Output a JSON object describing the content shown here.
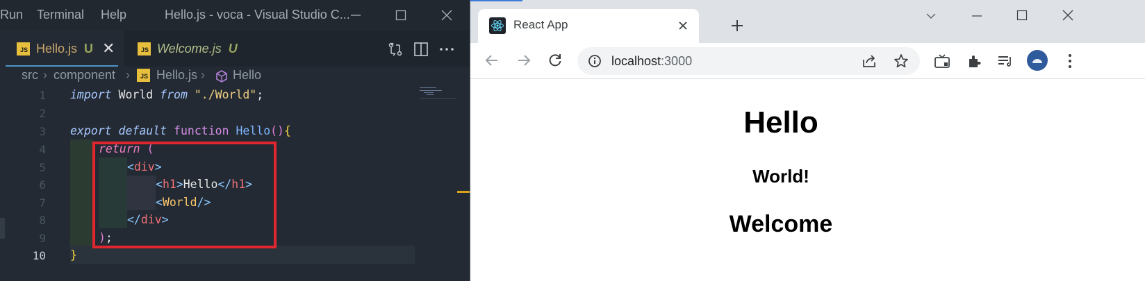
{
  "vscode": {
    "menu": [
      "Run",
      "Terminal",
      "Help"
    ],
    "window_title": "Hello.js - voca - Visual Studio C...",
    "tabs": [
      {
        "name": "Hello.js",
        "status": "U",
        "close": "✕",
        "active": true
      },
      {
        "name": "Welcome.js",
        "status": "U",
        "active": false
      }
    ],
    "breadcrumb": [
      "src",
      "component",
      "Hello.js",
      "Hello"
    ],
    "line_numbers": [
      "1",
      "2",
      "3",
      "4",
      "5",
      "6",
      "7",
      "8",
      "9",
      "10"
    ],
    "code": {
      "l1": {
        "import": "import",
        "ident": " World ",
        "from": "from",
        "path": " \"./World\"",
        "semi": ";"
      },
      "l3": {
        "export": "export",
        "default": "default",
        "function": "function",
        "name": "Hello",
        "open": "()",
        "brace": "{"
      },
      "l4": {
        "return": "return",
        "paren": "("
      },
      "l5": {
        "lt": "<",
        "tag": "div",
        "gt": ">"
      },
      "l6": {
        "lt": "<",
        "tag": "h1",
        "gt": ">",
        "text": "Hello",
        "close_lt": "</",
        "close_tag": "h1",
        "close_gt": ">"
      },
      "l7": {
        "lt": "<",
        "comp": "World",
        "end": "/>"
      },
      "l8": {
        "lt": "</",
        "tag": "div",
        "gt": ">"
      },
      "l9": {
        "paren": ")",
        "semi": ";"
      },
      "l10": {
        "brace": "}"
      }
    },
    "highlight_color": "#e0262f"
  },
  "chrome": {
    "tab_title": "React App",
    "url_host": "localhost",
    "url_port": ":3000",
    "page": {
      "h1": "Hello",
      "world": "World!",
      "welcome": "Welcome"
    }
  }
}
